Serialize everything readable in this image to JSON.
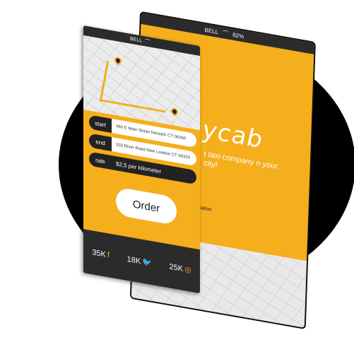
{
  "back_phone": {
    "status": {
      "carrier": "BELL",
      "battery": "82%"
    },
    "logo_text": "ycab",
    "tagline": "t taxi company n your city!",
    "choose_location": "choose location",
    "chevron_icon": "chevron-down-icon"
  },
  "front_phone": {
    "status": {
      "carrier": "BELL"
    },
    "form": {
      "start_label": "start",
      "start_value": "450 E Main Street Norwich CT 06360",
      "end_label": "end",
      "end_value": "333 River Road New London CT 06320",
      "rate_label": "rate",
      "rate_value": "$2,5 per kilometer"
    },
    "order_label": "Order",
    "social": [
      {
        "count": "35K",
        "icon": "f",
        "name": "facebook-icon"
      },
      {
        "count": "18K",
        "icon": "🐦",
        "name": "twitter-icon"
      },
      {
        "count": "25K",
        "icon": "◎",
        "name": "dribbble-icon"
      }
    ]
  },
  "colors": {
    "accent": "#f5ae1c",
    "dark": "#2b2b2b"
  }
}
